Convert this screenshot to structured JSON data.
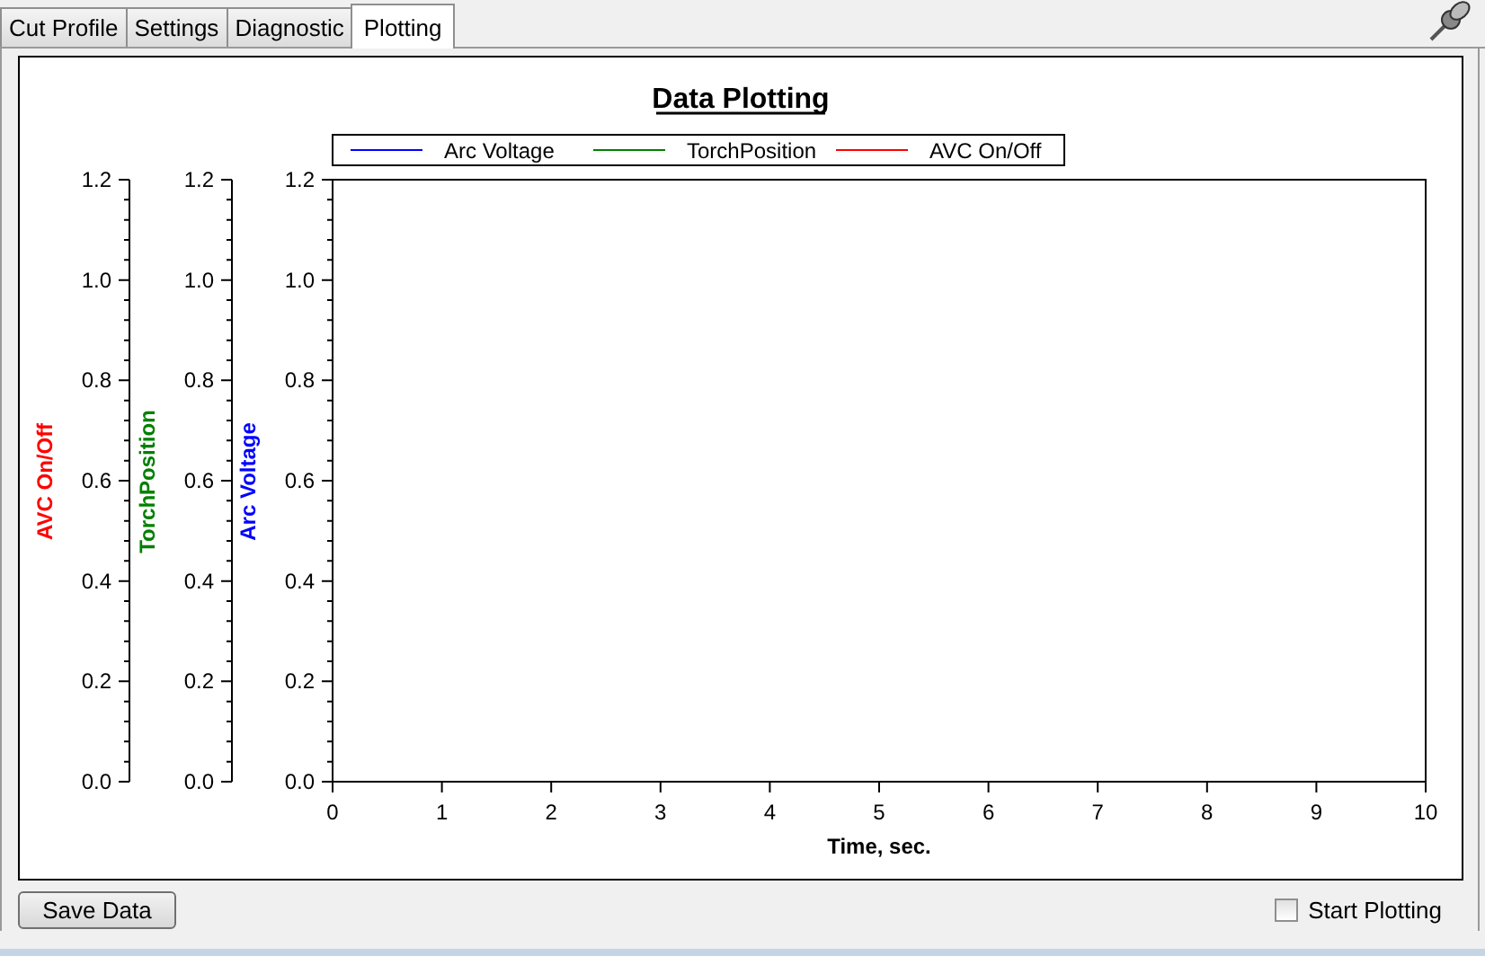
{
  "tabs": [
    {
      "label": "Cut Profile",
      "selected": false
    },
    {
      "label": "Settings",
      "selected": false
    },
    {
      "label": "Diagnostic",
      "selected": false
    },
    {
      "label": "Plotting",
      "selected": true
    }
  ],
  "plot": {
    "chart_data": {
      "type": "line",
      "title": "Data Plotting",
      "xlabel": "Time, sec.",
      "ylabel": [
        "AVC On/Off",
        "TorchPosition",
        "Arc Voltage"
      ],
      "categories": [
        "0",
        "1",
        "2",
        "3",
        "4",
        "5",
        "6",
        "7",
        "8",
        "9",
        "10"
      ],
      "ylim": [
        0,
        1.2
      ],
      "yticks": [
        {
          "value": 0,
          "label": "0.0"
        },
        {
          "value": 0.2,
          "label": "0.2"
        },
        {
          "value": 0.4,
          "label": "0.4"
        },
        {
          "value": 0.6,
          "label": "0.6"
        },
        {
          "value": 0.8,
          "label": "0.8"
        },
        {
          "value": 1,
          "label": "1.0"
        },
        {
          "value": 1.2,
          "label": "1.2"
        }
      ],
      "series": [
        {
          "name": "Arc Voltage",
          "color": "#0000ff",
          "values": [
            null,
            null,
            null,
            null,
            null,
            null,
            null,
            null,
            null,
            null,
            null
          ]
        },
        {
          "name": "TorchPosition",
          "color": "#008000",
          "values": [
            null,
            null,
            null,
            null,
            null,
            null,
            null,
            null,
            null,
            null,
            null
          ]
        },
        {
          "name": "AVC On/Off",
          "color": "#ff0000",
          "values": [
            null,
            null,
            null,
            null,
            null,
            null,
            null,
            null,
            null,
            null,
            null
          ]
        }
      ]
    }
  },
  "save_button": "Save Data",
  "start_plotting": {
    "label": "Start Plotting",
    "checked": false
  }
}
